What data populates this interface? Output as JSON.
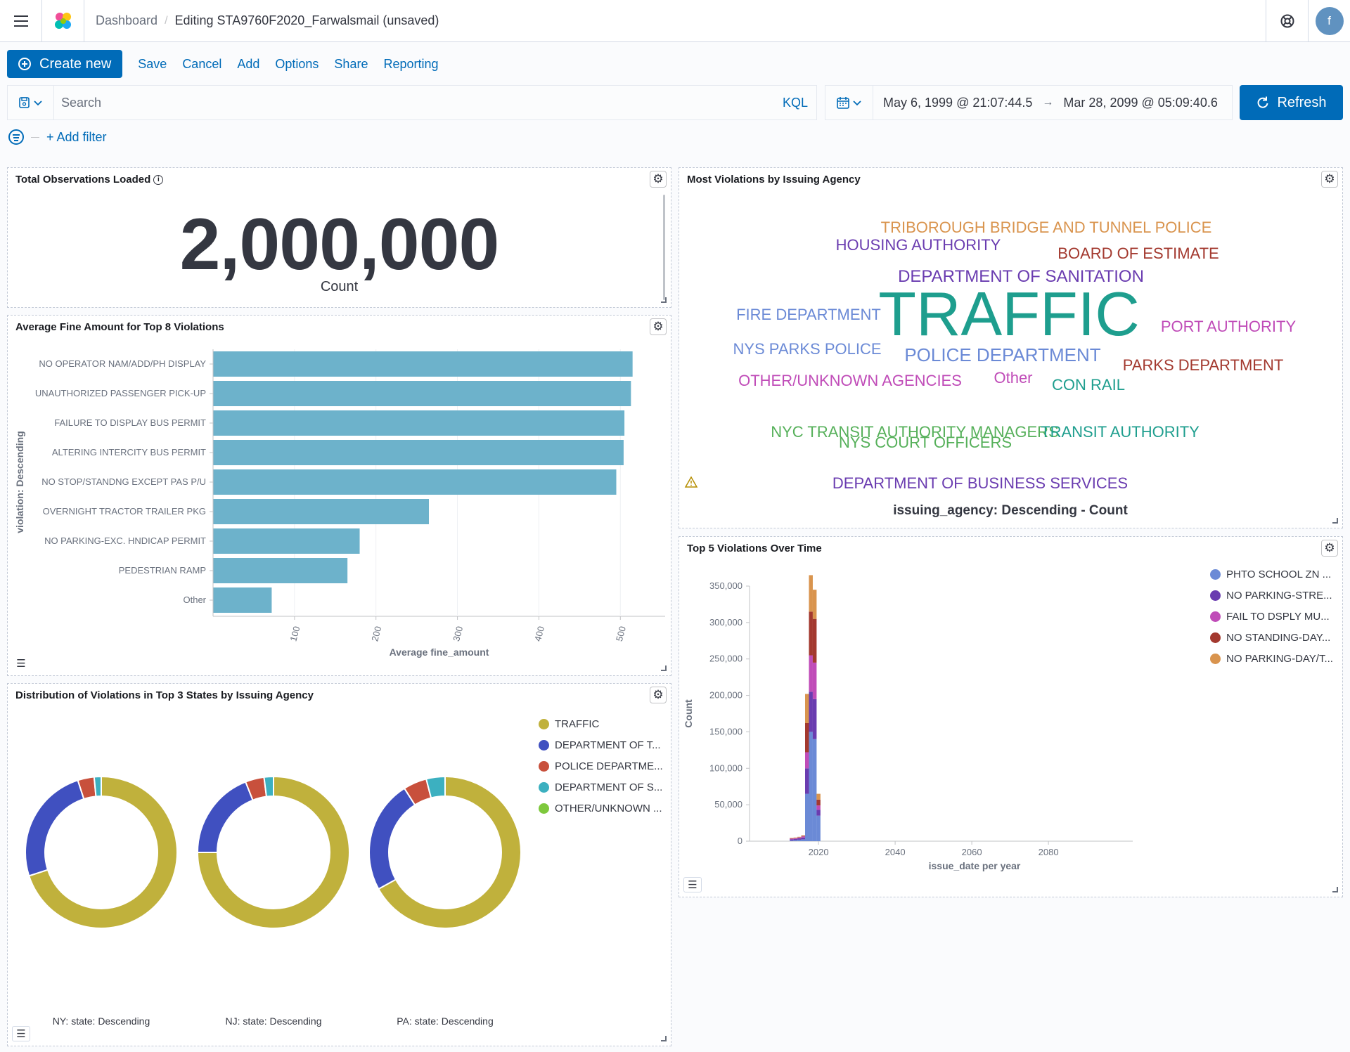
{
  "header": {
    "breadcrumb_root": "Dashboard",
    "breadcrumb_current": "Editing STA9760F2020_Farwalsmail (unsaved)",
    "avatar_initial": "f"
  },
  "topnav": {
    "create_label": "Create new",
    "links": [
      "Save",
      "Cancel",
      "Add",
      "Options",
      "Share",
      "Reporting"
    ]
  },
  "query": {
    "placeholder": "Search",
    "language": "KQL"
  },
  "time": {
    "start": "May 6, 1999 @ 21:07:44.5",
    "end": "Mar 28, 2099 @ 05:09:40.6",
    "refresh_label": "Refresh"
  },
  "filters": {
    "add_label": "+ Add filter"
  },
  "colors": {
    "primary": "#006bb8",
    "bar": "#6db2cb",
    "traffic": "#c0b13c",
    "dept_t": "#4050c0",
    "police": "#c8503c",
    "dept_s": "#3cb0c0",
    "other_unknown": "#7ec83c"
  },
  "panels": {
    "metric": {
      "title": "Total Observations Loaded",
      "value": "2,000,000",
      "label": "Count"
    },
    "avg_fine": {
      "title": "Average Fine Amount for Top 8 Violations"
    },
    "word_cloud": {
      "title": "Most Violations by Issuing Agency",
      "caption": "issuing_agency: Descending - Count",
      "words": [
        {
          "text": "TRIBOROUGH BRIDGE AND TUNNEL POLICE",
          "color": "#d9944e"
        },
        {
          "text": "HOUSING AUTHORITY",
          "color": "#6a3cb0"
        },
        {
          "text": "BOARD OF ESTIMATE",
          "color": "#a3392f"
        },
        {
          "text": "DEPARTMENT OF SANITATION",
          "color": "#6a3cb0"
        },
        {
          "text": "FIRE DEPARTMENT",
          "color": "#6b8ad6"
        },
        {
          "text": "TRAFFIC",
          "color": "#1e9e8e"
        },
        {
          "text": "PORT AUTHORITY",
          "color": "#c04cb8"
        },
        {
          "text": "NYS PARKS POLICE",
          "color": "#6b8ad6"
        },
        {
          "text": "POLICE DEPARTMENT",
          "color": "#6b8ad6"
        },
        {
          "text": "PARKS DEPARTMENT",
          "color": "#a3392f"
        },
        {
          "text": "OTHER/UNKNOWN AGENCIES",
          "color": "#c04cb8"
        },
        {
          "text": "Other",
          "color": "#c04cb8"
        },
        {
          "text": "CON RAIL",
          "color": "#1e9e8e"
        },
        {
          "text": "NYC TRANSIT AUTHORITY MANAGERS",
          "color": "#56b05a"
        },
        {
          "text": "TRANSIT AUTHORITY",
          "color": "#1e9e8e"
        },
        {
          "text": "NYS COURT OFFICERS",
          "color": "#56b05a"
        },
        {
          "text": "DEPARTMENT OF BUSINESS SERVICES",
          "color": "#6a3cb0"
        }
      ]
    },
    "distribution": {
      "title": "Distribution of Violations in Top 3 States by Issuing Agency",
      "legend": [
        "TRAFFIC",
        "DEPARTMENT OF T...",
        "POLICE DEPARTME...",
        "DEPARTMENT OF S...",
        "OTHER/UNKNOWN ..."
      ]
    },
    "over_time": {
      "title": "Top 5 Violations Over Time",
      "legend": [
        "PHTO SCHOOL ZN ...",
        "NO PARKING-STRE...",
        "FAIL TO DSPLY MU...",
        "NO STANDING-DAY...",
        "NO PARKING-DAY/T..."
      ]
    }
  },
  "chart_data": [
    {
      "type": "bar",
      "orientation": "horizontal",
      "categories": [
        "NO OPERATOR NAM/ADD/PH DISPLAY",
        "UNAUTHORIZED PASSENGER PICK-UP",
        "FAILURE TO DISPLAY BUS PERMIT",
        "ALTERING INTERCITY BUS PERMIT",
        "NO STOP/STANDNG EXCEPT PAS P/U",
        "OVERNIGHT TRACTOR TRAILER PKG",
        "NO PARKING-EXC. HNDICAP PERMIT",
        "PEDESTRIAN RAMP",
        "Other"
      ],
      "values": [
        515,
        513,
        505,
        504,
        495,
        265,
        180,
        165,
        72
      ],
      "xlabel": "Average fine_amount",
      "ylabel": "violation: Descending",
      "xticks": [
        100,
        200,
        300,
        400,
        500
      ],
      "xlim": [
        0,
        555
      ],
      "grid": true
    },
    {
      "type": "pie",
      "donut": true,
      "charts": [
        {
          "label": "NY: state: Descending",
          "slices": [
            {
              "name": "TRAFFIC",
              "value": 0.7
            },
            {
              "name": "DEPARTMENT OF T...",
              "value": 0.25
            },
            {
              "name": "POLICE DEPARTME...",
              "value": 0.035
            },
            {
              "name": "DEPARTMENT OF S...",
              "value": 0.015
            }
          ]
        },
        {
          "label": "NJ: state: Descending",
          "slices": [
            {
              "name": "TRAFFIC",
              "value": 0.75
            },
            {
              "name": "DEPARTMENT OF T...",
              "value": 0.19
            },
            {
              "name": "POLICE DEPARTME...",
              "value": 0.04
            },
            {
              "name": "DEPARTMENT OF S...",
              "value": 0.02
            }
          ]
        },
        {
          "label": "PA: state: Descending",
          "slices": [
            {
              "name": "TRAFFIC",
              "value": 0.67
            },
            {
              "name": "DEPARTMENT OF T...",
              "value": 0.24
            },
            {
              "name": "POLICE DEPARTME...",
              "value": 0.05
            },
            {
              "name": "DEPARTMENT OF S...",
              "value": 0.04
            }
          ]
        }
      ],
      "legend_position": "right"
    },
    {
      "type": "bar",
      "stacked": true,
      "xlabel": "issue_date per year",
      "ylabel": "Count",
      "ylim": [
        0,
        350000
      ],
      "yticks": [
        0,
        50000,
        100000,
        150000,
        200000,
        250000,
        300000,
        350000
      ],
      "xticks": [
        2020,
        2040,
        2060,
        2080
      ],
      "xlim": [
        2002,
        2102
      ],
      "x": [
        2013,
        2014,
        2015,
        2016,
        2017,
        2018,
        2019,
        2020
      ],
      "series": [
        {
          "name": "PHTO SCHOOL ZN ...",
          "values": [
            1000,
            1500,
            2000,
            2500,
            65000,
            150000,
            140000,
            35000
          ]
        },
        {
          "name": "NO PARKING-STRE...",
          "values": [
            1500,
            1500,
            2000,
            2500,
            35000,
            55000,
            55000,
            8000
          ]
        },
        {
          "name": "FAIL TO DSPLY MU...",
          "values": [
            1000,
            1000,
            1000,
            1500,
            22000,
            50000,
            50000,
            6000
          ]
        },
        {
          "name": "NO STANDING-DAY...",
          "values": [
            500,
            500,
            500,
            1000,
            40000,
            60000,
            60000,
            8000
          ]
        },
        {
          "name": "NO PARKING-DAY/T...",
          "values": [
            500,
            500,
            500,
            500,
            40000,
            50000,
            40000,
            8000
          ]
        }
      ],
      "legend_position": "top-right",
      "grid": false
    }
  ]
}
